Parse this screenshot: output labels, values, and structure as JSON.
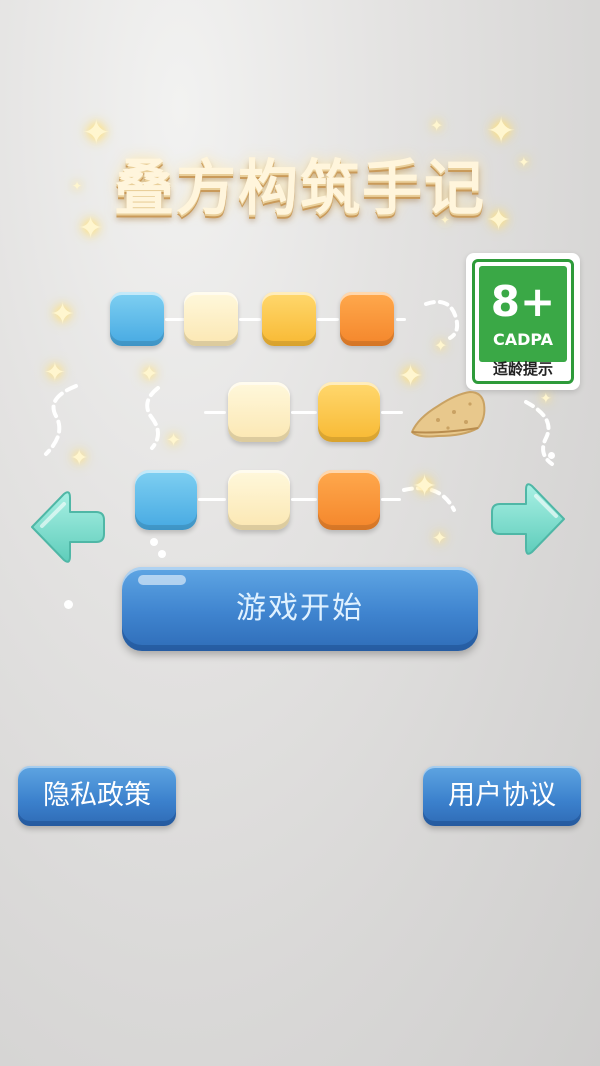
{
  "title": "叠方构筑手记",
  "age_badge": {
    "age": "8+",
    "code": "CADPA",
    "text": "适龄提示"
  },
  "buttons": {
    "start": "游戏开始",
    "privacy": "隐私政策",
    "agreement": "用户协议"
  },
  "icons": {
    "left_arrow": "arrow-left-icon",
    "right_arrow": "arrow-right-icon",
    "sparkle": "sparkle-icon"
  },
  "colors": {
    "tile_blue": "#46a9e2",
    "tile_cream": "#fbe7b2",
    "tile_yellow": "#f8b933",
    "tile_orange": "#f4862b",
    "button_blue": "#3f84cf",
    "arrow_mint": "#7fe0d2",
    "badge_green": "#3aa846"
  }
}
